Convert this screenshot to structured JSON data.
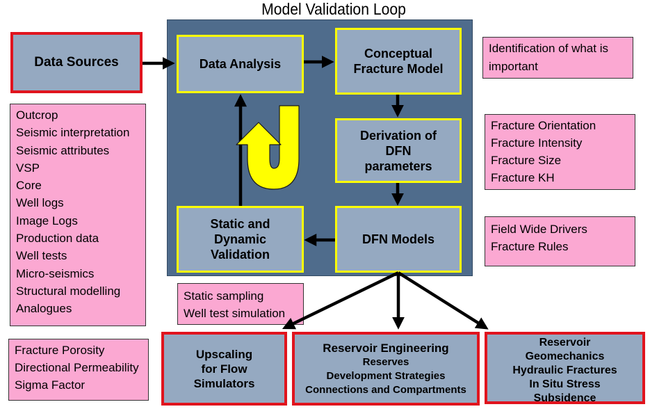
{
  "title": "Model Validation Loop",
  "colors": {
    "loop_panel": "#4f6c8c",
    "box_fill": "#95a9c1",
    "loop_border": "#ffff00",
    "output_border": "#e0141e",
    "note_fill": "#fba8d2",
    "arrow": "#000000"
  },
  "data_sources": {
    "label": "Data Sources"
  },
  "data_source_list": [
    "Outcrop",
    "Seismic interpretation",
    "Seismic attributes",
    "VSP",
    "Core",
    "Well logs",
    "Image Logs",
    "Production data",
    "Well tests",
    "Micro-seismics",
    "Structural modelling",
    "Analogues"
  ],
  "properties_list": [
    "Fracture Porosity",
    "Directional Permeability",
    "Sigma Factor"
  ],
  "loop": {
    "data_analysis": "Data Analysis",
    "conceptual": [
      "Conceptual",
      "Fracture Model"
    ],
    "derivation": [
      "Derivation of",
      "DFN",
      "parameters"
    ],
    "dfn_models": "DFN Models",
    "validation": [
      "Static and",
      "Dynamic",
      "Validation"
    ],
    "cycle_icon": "u-turn-arrow-icon"
  },
  "notes": {
    "identification": [
      "Identification of what is",
      "important"
    ],
    "fracture_params": [
      "Fracture Orientation",
      "Fracture Intensity",
      "Fracture Size",
      "Fracture KH"
    ],
    "drivers": [
      "Field Wide Drivers",
      "Fracture Rules"
    ],
    "sampling": [
      "Static sampling",
      "Well test simulation"
    ]
  },
  "outputs": {
    "upscaling": [
      "Upscaling",
      "for Flow",
      "Simulators"
    ],
    "reservoir_engineering": {
      "title": "Reservoir Engineering",
      "items": [
        "Reserves",
        "Development Strategies",
        "Connections and Compartments"
      ]
    },
    "geomechanics": {
      "title": [
        "Reservoir",
        "Geomechanics"
      ],
      "items": [
        "Hydraulic Fractures",
        "In Situ Stress",
        "Subsidence"
      ]
    }
  }
}
